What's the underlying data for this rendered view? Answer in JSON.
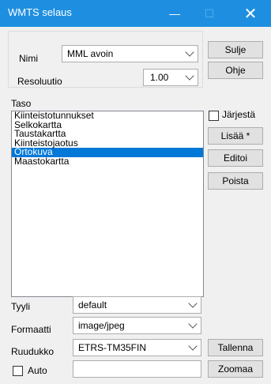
{
  "window": {
    "title": "WMTS selaus"
  },
  "form": {
    "nimi_label": "Nimi",
    "nimi_value": "MML avoin",
    "resoluutio_label": "Resoluutio",
    "resoluutio_value": "1.00",
    "taso_label": "Taso",
    "tyyli_label": "Tyyli",
    "tyyli_value": "default",
    "formaatti_label": "Formaatti",
    "formaatti_value": "image/jpeg",
    "ruudukko_label": "Ruudukko",
    "ruudukko_value": "ETRS-TM35FIN",
    "auto_label": "Auto",
    "jarjesta_label": "Järjestä"
  },
  "buttons": {
    "sulje": "Sulje",
    "ohje": "Ohje",
    "lisaa": "Lisää *",
    "editoi": "Editoi",
    "poista": "Poista",
    "tallenna": "Tallenna",
    "zoomaa": "Zoomaa"
  },
  "layers": [
    "Kiinteistotunnukset",
    "Selkokartta",
    "Taustakartta",
    "Kiinteistojaotus",
    "Ortokuva",
    "Maastokartta"
  ],
  "selected_layer": "Ortokuva",
  "colors": {
    "titlebar": "#1e8fe0",
    "selection": "#0078d7"
  }
}
